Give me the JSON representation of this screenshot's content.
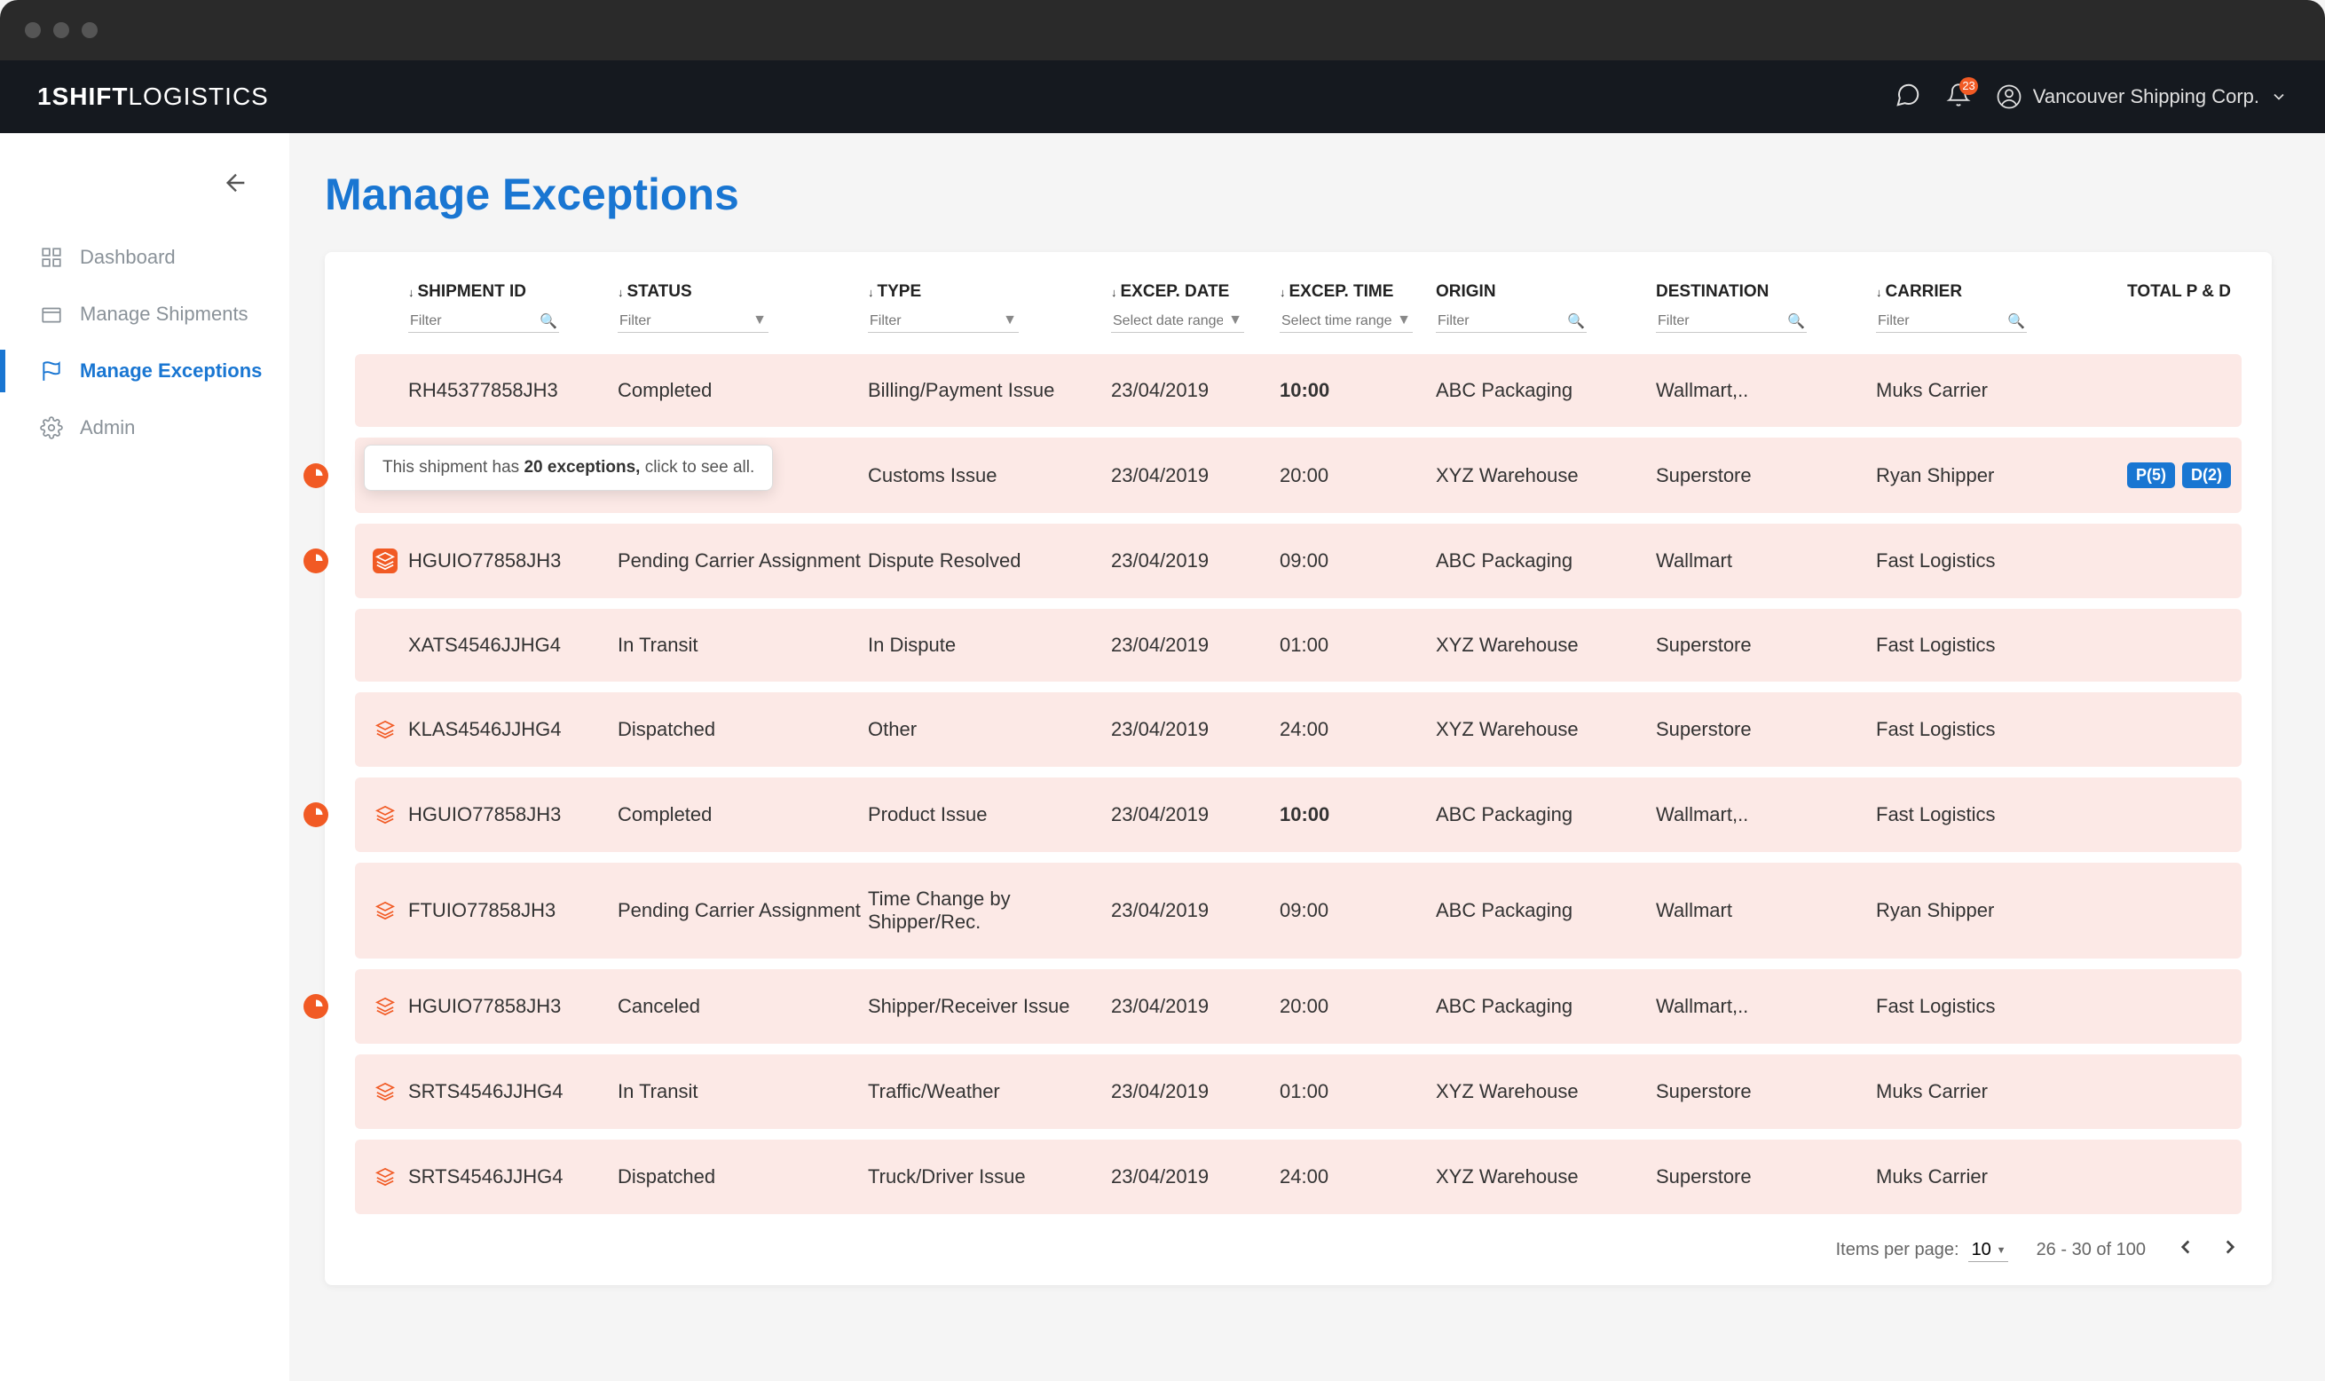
{
  "logo": {
    "bold": "1SHIFT",
    "light": "LOGISTICS"
  },
  "notificationCount": "23",
  "userName": "Vancouver Shipping Corp.",
  "sidebar": {
    "items": [
      {
        "label": "Dashboard",
        "icon": "dashboard"
      },
      {
        "label": "Manage Shipments",
        "icon": "box"
      },
      {
        "label": "Manage Exceptions",
        "icon": "flag"
      },
      {
        "label": "Admin",
        "icon": "gear"
      }
    ]
  },
  "pageTitle": "Manage Exceptions",
  "columns": {
    "shipmentId": "SHIPMENT ID",
    "status": "STATUS",
    "type": "TYPE",
    "excepDate": "EXCEP. DATE",
    "excepTime": "EXCEP. TIME",
    "origin": "ORIGIN",
    "destination": "DESTINATION",
    "carrier": "CARRIER",
    "totalPD": "TOTAL P & D"
  },
  "filters": {
    "filter": "Filter",
    "selectDateRange": "Select date range",
    "selectTimeRange": "Select time range"
  },
  "tooltip": {
    "pre": "This shipment has ",
    "count": "20 exceptions,",
    "post": " click to see all."
  },
  "rows": [
    {
      "clock": false,
      "stack": "none",
      "id": "RH45377858JH3",
      "status": "Completed",
      "type": "Billing/Payment Issue",
      "date": "23/04/2019",
      "time": "10:00",
      "timeBold": true,
      "origin": "ABC Packaging",
      "dest": "Wallmart,..",
      "carrier": "Muks Carrier",
      "p": "",
      "d": ""
    },
    {
      "clock": true,
      "stack": "none",
      "id": "",
      "status": "",
      "type": "Customs Issue",
      "date": "23/04/2019",
      "time": "20:00",
      "timeBold": false,
      "origin": "XYZ Warehouse",
      "dest": "Superstore",
      "carrier": "Ryan Shipper",
      "p": "P(5)",
      "d": "D(2)"
    },
    {
      "clock": true,
      "stack": "solid",
      "id": "HGUIO77858JH3",
      "status": "Pending Carrier Assignment",
      "type": "Dispute Resolved",
      "date": "23/04/2019",
      "time": "09:00",
      "timeBold": false,
      "origin": "ABC Packaging",
      "dest": "Wallmart",
      "carrier": "Fast Logistics",
      "p": "",
      "d": ""
    },
    {
      "clock": false,
      "stack": "none",
      "id": "XATS4546JJHG4",
      "status": "In Transit",
      "type": "In Dispute",
      "date": "23/04/2019",
      "time": "01:00",
      "timeBold": false,
      "origin": "XYZ Warehouse",
      "dest": "Superstore",
      "carrier": "Fast Logistics",
      "p": "",
      "d": ""
    },
    {
      "clock": false,
      "stack": "outline",
      "id": "KLAS4546JJHG4",
      "status": "Dispatched",
      "type": "Other",
      "date": "23/04/2019",
      "time": "24:00",
      "timeBold": false,
      "origin": "XYZ Warehouse",
      "dest": "Superstore",
      "carrier": "Fast Logistics",
      "p": "",
      "d": ""
    },
    {
      "clock": true,
      "stack": "outline",
      "id": "HGUIO77858JH3",
      "status": "Completed",
      "type": "Product Issue",
      "date": "23/04/2019",
      "time": "10:00",
      "timeBold": true,
      "origin": "ABC Packaging",
      "dest": "Wallmart,..",
      "carrier": "Fast Logistics",
      "p": "",
      "d": ""
    },
    {
      "clock": false,
      "stack": "outline",
      "id": "FTUIO77858JH3",
      "status": "Pending Carrier Assignment",
      "type": "Time Change by Shipper/Rec.",
      "date": "23/04/2019",
      "time": "09:00",
      "timeBold": false,
      "origin": "ABC Packaging",
      "dest": "Wallmart",
      "carrier": "Ryan Shipper",
      "p": "",
      "d": ""
    },
    {
      "clock": true,
      "stack": "outline",
      "id": "HGUIO77858JH3",
      "status": "Canceled",
      "type": "Shipper/Receiver Issue",
      "date": "23/04/2019",
      "time": "20:00",
      "timeBold": false,
      "origin": "ABC Packaging",
      "dest": "Wallmart,..",
      "carrier": "Fast Logistics",
      "p": "",
      "d": ""
    },
    {
      "clock": false,
      "stack": "outline",
      "id": "SRTS4546JJHG4",
      "status": "In Transit",
      "type": "Traffic/Weather",
      "date": "23/04/2019",
      "time": "01:00",
      "timeBold": false,
      "origin": "XYZ Warehouse",
      "dest": "Superstore",
      "carrier": "Muks Carrier",
      "p": "",
      "d": ""
    },
    {
      "clock": false,
      "stack": "outline",
      "id": "SRTS4546JJHG4",
      "status": "Dispatched",
      "type": "Truck/Driver Issue",
      "date": "23/04/2019",
      "time": "24:00",
      "timeBold": false,
      "origin": "XYZ Warehouse",
      "dest": "Superstore",
      "carrier": "Muks Carrier",
      "p": "",
      "d": ""
    }
  ],
  "pager": {
    "itemsLabel": "Items per page:",
    "perPage": "10",
    "range": "26 - 30 of 100"
  }
}
